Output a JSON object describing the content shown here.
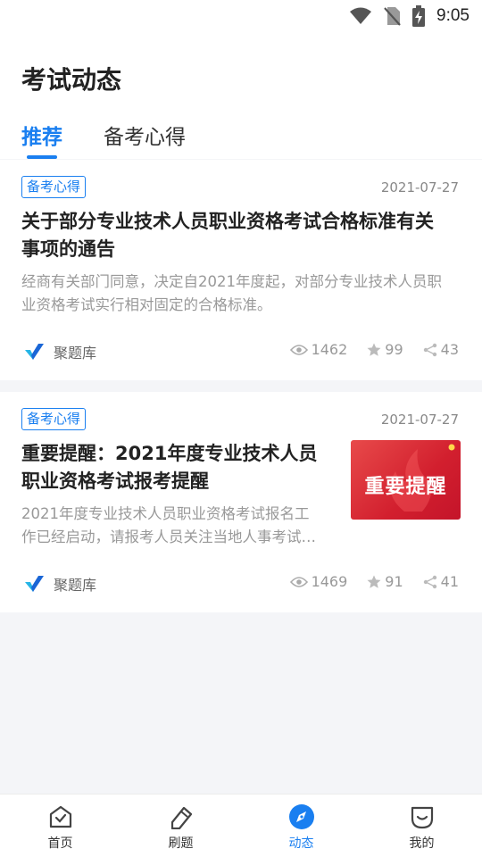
{
  "status": {
    "time": "9:05"
  },
  "header": {
    "title": "考试动态",
    "tabs": [
      {
        "label": "推荐",
        "active": true
      },
      {
        "label": "备考心得",
        "active": false
      }
    ]
  },
  "articles": [
    {
      "tag": "备考心得",
      "date": "2021-07-27",
      "title_line1": "关于部分专业技术人员职业资格考试合格标准有关",
      "title_line2": "事项的通告",
      "summary_line1": "经商有关部门同意，决定自2021年度起，对部分专业技术人员职",
      "summary_line2": "业资格考试实行相对固定的合格标准。",
      "source": "聚题库",
      "views": "1462",
      "stars": "99",
      "shares": "43"
    },
    {
      "tag": "备考心得",
      "date": "2021-07-27",
      "title_line1": "重要提醒：2021年度专业技术人员",
      "title_line2": "职业资格考试报考提醒",
      "summary_line1": "2021年度专业技术人员职业资格考试报名工",
      "summary_line2": "作已经启动，请报考人员关注当地人事考试…",
      "thumbnail_text": "重要提醒",
      "source": "聚题库",
      "views": "1469",
      "stars": "91",
      "shares": "41"
    }
  ],
  "bottom_nav": [
    {
      "label": "首页",
      "icon": "home-check-icon",
      "active": false
    },
    {
      "label": "刷题",
      "icon": "pencil-icon",
      "active": false
    },
    {
      "label": "动态",
      "icon": "compass-icon",
      "active": true
    },
    {
      "label": "我的",
      "icon": "profile-face-icon",
      "active": false
    }
  ],
  "colors": {
    "accent": "#1a7ff0",
    "background": "#f4f5f8",
    "thumbnail_red": "#d21f2e"
  }
}
